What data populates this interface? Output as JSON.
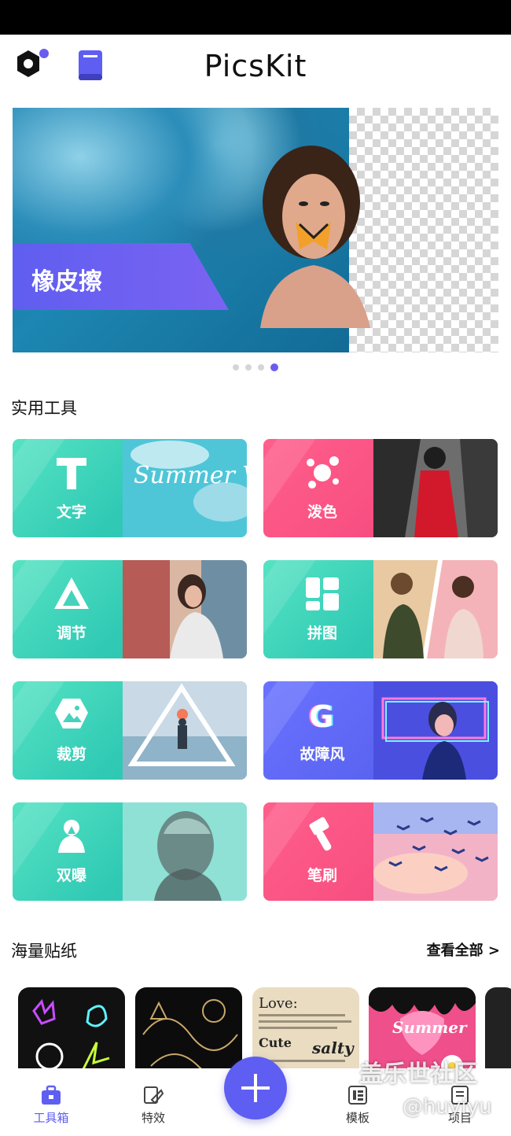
{
  "app": {
    "title": "PicsKit"
  },
  "banner": {
    "label": "橡皮擦",
    "page_count": 4,
    "active_page": 4
  },
  "sections": {
    "tools_title": "实用工具",
    "stickers_title": "海量贴纸",
    "see_all": "查看全部 >"
  },
  "tools": [
    {
      "label": "文字",
      "icon": "text-icon",
      "theme": "teal",
      "overlay": "Summer Vibe"
    },
    {
      "label": "泼色",
      "icon": "splash-icon",
      "theme": "pink"
    },
    {
      "label": "调节",
      "icon": "adjust-icon",
      "theme": "teal"
    },
    {
      "label": "拼图",
      "icon": "collage-icon",
      "theme": "teal"
    },
    {
      "label": "裁剪",
      "icon": "crop-icon",
      "theme": "teal"
    },
    {
      "label": "故障风",
      "icon": "glitch-icon",
      "theme": "blue"
    },
    {
      "label": "双曝",
      "icon": "double-exposure-icon",
      "theme": "teal"
    },
    {
      "label": "笔刷",
      "icon": "brush-icon",
      "theme": "pink"
    }
  ],
  "stickers": [
    {
      "name": "neon"
    },
    {
      "name": "gold-line"
    },
    {
      "text_title": "Love:",
      "text_body": "Cute",
      "text_tag": "salty"
    },
    {
      "text_title": "Summer"
    }
  ],
  "nav": {
    "items": [
      {
        "label": "工具箱",
        "icon": "toolbox-icon",
        "active": true
      },
      {
        "label": "特效",
        "icon": "effects-icon",
        "active": false
      },
      {
        "label": "模板",
        "icon": "template-icon",
        "active": false
      },
      {
        "label": "项目",
        "icon": "project-icon",
        "active": false
      }
    ]
  },
  "watermark": {
    "line1": "盖乐世社区",
    "line2": "@huyiyu"
  },
  "colors": {
    "accent": "#5e5ef2",
    "teal": "#2fc9b4",
    "pink": "#f2437a",
    "blue": "#5560ee"
  }
}
